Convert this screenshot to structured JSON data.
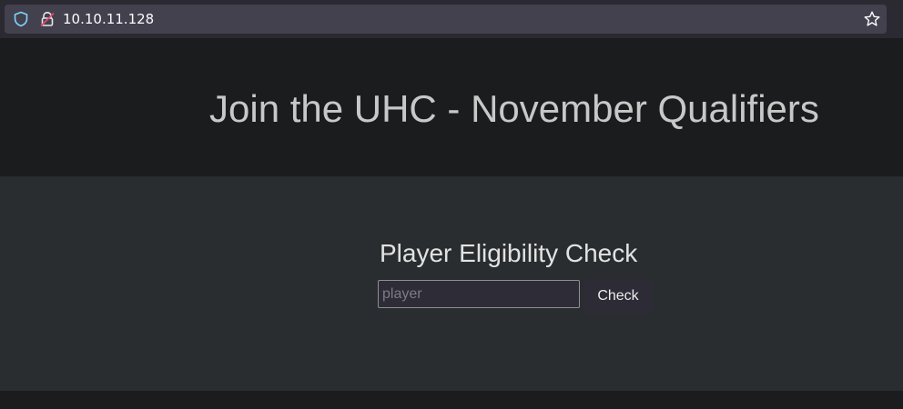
{
  "browser": {
    "url": "10.10.11.128",
    "icons": [
      "shield-icon",
      "lock-icon",
      "star-icon"
    ]
  },
  "hero": {
    "title": "Join the UHC - November Qualifiers"
  },
  "eligibility": {
    "title": "Player Eligibility Check",
    "input_placeholder": "player",
    "input_value": "",
    "button_label": "Check"
  },
  "colors": {
    "page_bg": "#1b1c1e",
    "panel_bg": "#292d30",
    "hero_text": "#c8c8c8",
    "browser_bar": "#2b2a33",
    "url_box": "#42414d",
    "shield_accent": "#7fd4ff",
    "lock_accent": "#e34b71"
  }
}
